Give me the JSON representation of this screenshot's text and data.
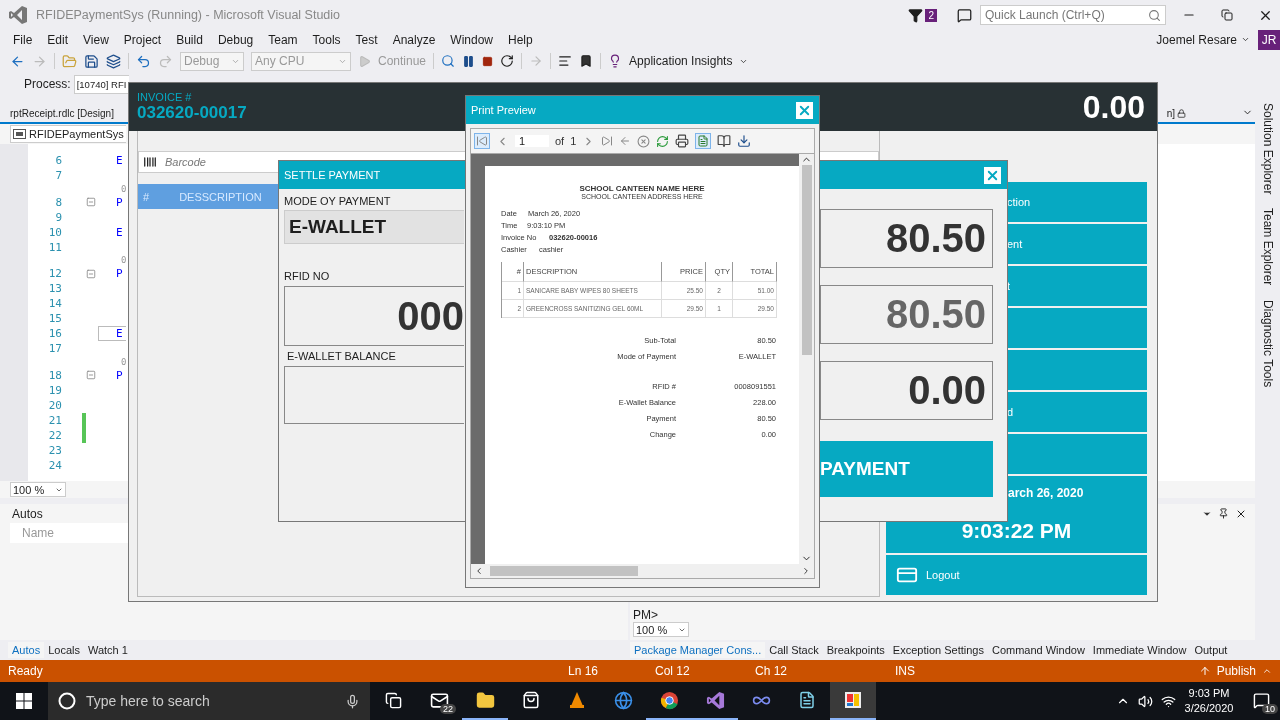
{
  "window": {
    "title": "RFIDEPaymentSys (Running) - Microsoft Visual Studio",
    "notification_count": "2",
    "quick_launch": {
      "placeholder": "Quick Launch (Ctrl+Q)"
    }
  },
  "menu": [
    "File",
    "Edit",
    "View",
    "Project",
    "Build",
    "Debug",
    "Team",
    "Tools",
    "Test",
    "Analyze",
    "Window",
    "Help"
  ],
  "account": {
    "name": "Joemel Resare",
    "initials": "JR"
  },
  "toolbar": {
    "configuration": "Debug",
    "platform": "Any CPU",
    "continue": "Continue",
    "insights": "Application Insights"
  },
  "process_bar": {
    "label": "Process:",
    "value": "[10740] RFI"
  },
  "document_tabs": [
    "rptReceipt.rdlc [Design]",
    "n]"
  ],
  "navigation_dropdown": "RFIDEPaymentSys",
  "code_lines": [
    {
      "kind": "line",
      "number": "6",
      "text": "E",
      "fold": false,
      "changed": false,
      "current": false
    },
    {
      "kind": "line",
      "number": "7",
      "fold": false,
      "changed": false,
      "current": false
    },
    {
      "kind": "codelens",
      "text": "0"
    },
    {
      "kind": "line",
      "number": "8",
      "text": "P",
      "fold": true,
      "changed": false,
      "current": false
    },
    {
      "kind": "line",
      "number": "9",
      "fold": false,
      "changed": false,
      "current": false
    },
    {
      "kind": "line",
      "number": "10",
      "text": "E",
      "fold": false,
      "changed": false,
      "current": false
    },
    {
      "kind": "line",
      "number": "11",
      "fold": false,
      "changed": false,
      "current": false
    },
    {
      "kind": "codelens",
      "text": "0"
    },
    {
      "kind": "line",
      "number": "12",
      "text": "P",
      "fold": true,
      "changed": false,
      "current": false
    },
    {
      "kind": "line",
      "number": "13",
      "fold": false,
      "changed": false,
      "current": false
    },
    {
      "kind": "line",
      "number": "14",
      "fold": false,
      "changed": false,
      "current": false
    },
    {
      "kind": "line",
      "number": "15",
      "fold": false,
      "changed": false,
      "current": false
    },
    {
      "kind": "line",
      "number": "16",
      "text": "E",
      "fold": false,
      "changed": false,
      "current": true
    },
    {
      "kind": "line",
      "number": "17",
      "fold": false,
      "changed": false,
      "current": false
    },
    {
      "kind": "codelens",
      "text": "0"
    },
    {
      "kind": "line",
      "number": "18",
      "text": "P",
      "fold": true,
      "changed": false,
      "current": false
    },
    {
      "kind": "line",
      "number": "19",
      "fold": false,
      "changed": false,
      "current": false
    },
    {
      "kind": "line",
      "number": "20",
      "fold": false,
      "changed": false,
      "current": false
    },
    {
      "kind": "line",
      "number": "21",
      "fold": false,
      "changed": true,
      "current": false
    },
    {
      "kind": "line",
      "number": "22",
      "fold": false,
      "changed": true,
      "current": false
    },
    {
      "kind": "line",
      "number": "23",
      "fold": false,
      "changed": false,
      "current": false
    },
    {
      "kind": "line",
      "number": "24",
      "fold": false,
      "changed": false,
      "current": false
    }
  ],
  "editor_zoom": "100 %",
  "autos_panel": {
    "title": "Autos",
    "column": "Name"
  },
  "bottom_left_tabs": [
    {
      "label": "Autos",
      "selected": true
    },
    {
      "label": "Locals",
      "selected": false
    },
    {
      "label": "Watch 1",
      "selected": false
    }
  ],
  "console": {
    "prompt": "PM>",
    "zoom": "100 %"
  },
  "bottom_right_tabs": [
    {
      "label": "Package Manager Cons...",
      "selected": true
    },
    {
      "label": "Call Stack",
      "selected": false
    },
    {
      "label": "Breakpoints",
      "selected": false
    },
    {
      "label": "Exception Settings",
      "selected": false
    },
    {
      "label": "Command Window",
      "selected": false
    },
    {
      "label": "Immediate Window",
      "selected": false
    },
    {
      "label": "Output",
      "selected": false
    }
  ],
  "side_tabs": [
    "Solution Explorer",
    "Team Explorer",
    "Diagnostic Tools"
  ],
  "status_bar": {
    "state": "Ready",
    "line": "Ln 16",
    "column": "Col 12",
    "char": "Ch 12",
    "mode": "INS",
    "publish": "Publish"
  },
  "taskbar": {
    "search_placeholder": "Type here to search",
    "mail_badge": "22",
    "time": "9:03 PM",
    "date": "3/26/2020",
    "notifications": "10"
  },
  "pos_window": {
    "invoice_label": "INVOICE #",
    "invoice_number": "032620-00017",
    "total": "0.00",
    "barcode": {
      "placeholder": "Barcode"
    },
    "table_columns": [
      "#",
      "DESSCRIPTION"
    ],
    "menu_buttons": [
      {
        "kind": "labeled",
        "label": "ction"
      },
      {
        "kind": "labeled",
        "label": "ent"
      },
      {
        "kind": "labeled",
        "label": "t"
      },
      {
        "kind": "blank"
      },
      {
        "kind": "blank"
      },
      {
        "kind": "labeled",
        "label": "d"
      },
      {
        "kind": "blank"
      }
    ],
    "date": "arch 26, 2020",
    "time": "9:03:22 PM",
    "logout": "Logout"
  },
  "settle_dialog": {
    "title": "SETTLE PAYMENT",
    "mode_label": "MODE OY PAYMENT",
    "mode": "E-WALLET",
    "rfid_label": "RFID NO",
    "rfid": "000",
    "balance_label": "E-WALLET BALANCE",
    "amounts": [
      {
        "value": "80.50",
        "disabled": false
      },
      {
        "value": "80.50",
        "disabled": true
      },
      {
        "value": "0.00",
        "disabled": false
      }
    ],
    "pay_button": "PAYMENT"
  },
  "print_preview": {
    "title": "Print Preview",
    "page": "1",
    "of": "of",
    "page_count": "1",
    "receipt": {
      "store_name": "SCHOOL CANTEEN NAME HERE",
      "store_address": "SCHOOL CANTEEN ADDRESS HERE",
      "info": [
        {
          "label": "Date",
          "value": "March 26, 2020",
          "bold": false
        },
        {
          "label": "Time",
          "value": "9:03:10 PM",
          "bold": false
        },
        {
          "label": "Invoice No",
          "value": "032620-00016",
          "bold": true
        },
        {
          "label": "Cashier",
          "value": "cashier",
          "bold": false
        }
      ],
      "columns": [
        "#",
        "DESCRIPTION",
        "PRICE",
        "QTY",
        "TOTAL"
      ],
      "items": [
        [
          "1",
          "SANICARE BABY WIPES 80 SHEETS",
          "25.50",
          "2",
          "51.00"
        ],
        [
          "2",
          "GREENCROSS SANITIZING GEL 60ML",
          "29.50",
          "1",
          "29.50"
        ]
      ],
      "summary_groups": [
        [
          {
            "label": "Sub-Total",
            "value": "80.50"
          },
          {
            "label": "Mode of Payment",
            "value": "E-WALLET"
          }
        ],
        [
          {
            "label": "RFID #",
            "value": "0008091551"
          },
          {
            "label": "E-Wallet Balance",
            "value": "228.00"
          },
          {
            "label": "Payment",
            "value": "80.50"
          },
          {
            "label": "Change",
            "value": "0.00"
          }
        ]
      ]
    }
  }
}
